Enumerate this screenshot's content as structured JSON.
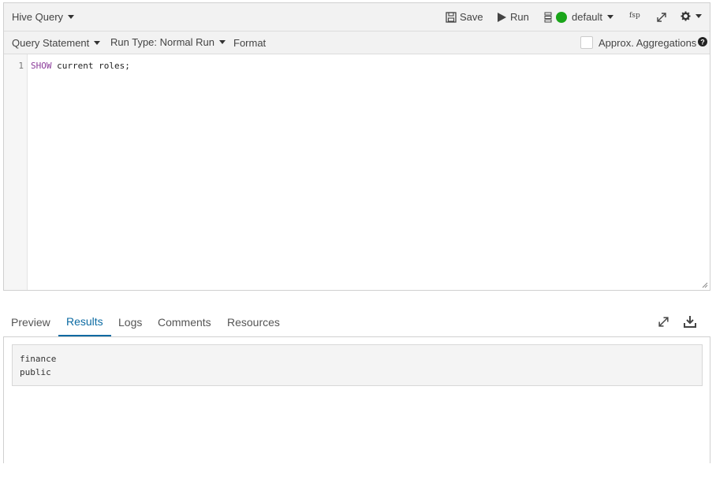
{
  "toolbar": {
    "query_type": "Hive Query",
    "save_label": "Save",
    "run_label": "Run",
    "database": "default",
    "format_icon_text": "fsp",
    "status_color": "#1aa51a"
  },
  "subbar": {
    "query_statement": "Query Statement",
    "run_type": "Run Type: Normal Run",
    "format_label": "Format",
    "approx_label": "Approx. Aggregations"
  },
  "editor": {
    "line_number": "1",
    "keyword": "SHOW",
    "rest": " current roles;"
  },
  "tabs": [
    "Preview",
    "Results",
    "Logs",
    "Comments",
    "Resources"
  ],
  "active_tab": "Results",
  "results": [
    "finance",
    "public"
  ]
}
